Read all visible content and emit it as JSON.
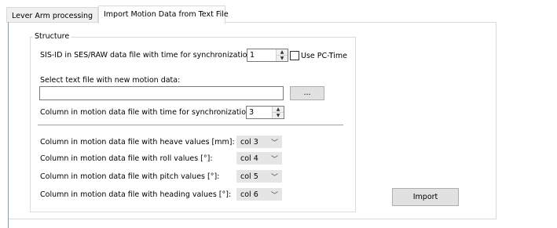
{
  "tabs": [
    {
      "label": "Lever Arm processing",
      "active": false
    },
    {
      "label": "Import Motion Data from Text File",
      "active": true
    }
  ],
  "structure": {
    "legend": "Structure",
    "sis_id_label": "SIS-ID in SES/RAW data file with time for synchronization:",
    "sis_id_value": "1",
    "use_pc_time_label": "Use PC-Time",
    "use_pc_time_checked": false,
    "select_file_label": "Select text file with new motion data:",
    "file_path_value": "",
    "browse_label": "...",
    "time_column_label": "Column in motion data file with time for synchronization:",
    "time_column_value": "3",
    "columns": [
      {
        "label": "Column in motion data file with heave values [mm]:",
        "value": "col 3"
      },
      {
        "label": "Column in motion data file with roll values [°]:",
        "value": "col 4"
      },
      {
        "label": "Column in motion data file with pitch values [°]:",
        "value": "col 5"
      },
      {
        "label": "Column in motion data file with heading values [°]:",
        "value": "col 6"
      }
    ]
  },
  "import_button_label": "Import"
}
